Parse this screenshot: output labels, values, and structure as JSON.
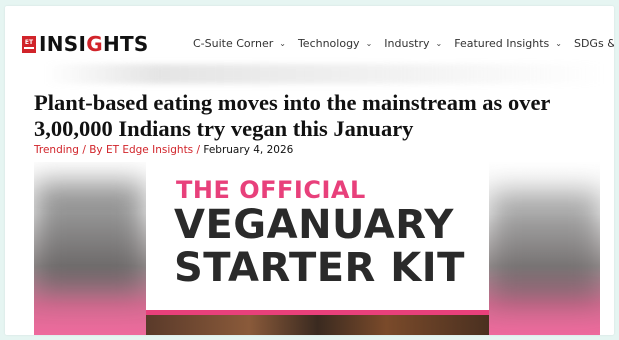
{
  "logo": {
    "badge_text": "ET",
    "text_a": "INSI",
    "text_b": "G",
    "text_c": "HTS"
  },
  "nav": [
    {
      "label": "C-Suite Corner"
    },
    {
      "label": "Technology"
    },
    {
      "label": "Industry"
    },
    {
      "label": "Featured Insights"
    },
    {
      "label": "SDGs & ESG"
    }
  ],
  "article": {
    "title": "Plant-based eating moves into the mainstream as over 3,00,000 Indians try vegan this January",
    "category": "Trending",
    "separator": " / ",
    "byline": "By ET Edge Insights",
    "date": "February 4, 2026"
  },
  "hero": {
    "line1": "THE OFFICIAL",
    "line2": "VEGANUARY",
    "line3": "STARTER KIT"
  },
  "colors": {
    "brand_red": "#d1242a",
    "accent_pink": "#e8407b",
    "page_bg": "#e6f5f2"
  }
}
